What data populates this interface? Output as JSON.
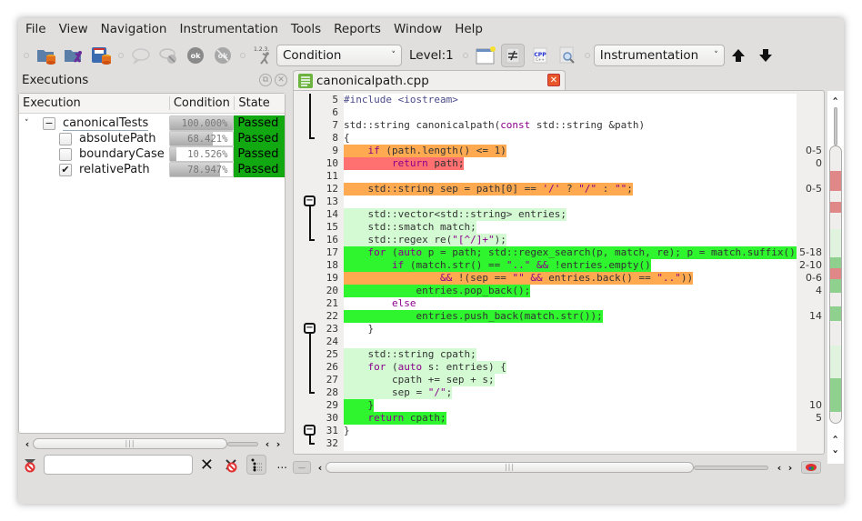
{
  "menu": [
    "File",
    "View",
    "Navigation",
    "Instrumentation",
    "Tools",
    "Reports",
    "Window",
    "Help"
  ],
  "toolbar": {
    "buttons": [
      "open-database-icon",
      "open-execution-icon",
      "save-database-icon",
      "comment-icon",
      "remove-comment-icon",
      "ok-icon",
      "undo-ok-icon",
      "level-stepper-icon"
    ],
    "coverage_method": "Condition",
    "level_label": "Level:1",
    "instrumentation_filter": "Instrumentation",
    "step_icon_label": "1.2.3."
  },
  "executions_dock": {
    "title": "Executions",
    "columns": [
      "Execution",
      "Condition %",
      "State"
    ],
    "rows": [
      {
        "name": "canonicalTests",
        "coverage": "100.000%",
        "coverage_value": 100.0,
        "state": "Passed",
        "checked": "partial",
        "level": 0
      },
      {
        "name": "absolutePath",
        "coverage": "68.421%",
        "coverage_value": 68.421,
        "state": "Passed",
        "checked": false,
        "level": 1
      },
      {
        "name": "boundaryCase",
        "coverage": "10.526%",
        "coverage_value": 10.526,
        "state": "Passed",
        "checked": false,
        "level": 1
      },
      {
        "name": "relativePath",
        "coverage": "78.947%",
        "coverage_value": 78.947,
        "state": "Passed",
        "checked": true,
        "level": 1
      }
    ],
    "filter_value": "",
    "more_label": "..."
  },
  "editor": {
    "tab_title": "canonicalpath.cpp",
    "lines": [
      {
        "n": 5,
        "text": "#include <iostream>",
        "bg": "none",
        "hits": ""
      },
      {
        "n": 6,
        "text": "",
        "bg": "none",
        "hits": ""
      },
      {
        "n": 7,
        "text": "std::string canonicalpath(const std::string &path)",
        "bg": "none",
        "hits": ""
      },
      {
        "n": 8,
        "text": "{",
        "bg": "none",
        "hits": ""
      },
      {
        "n": 9,
        "text": "    if (path.length() <= 1)",
        "bg": "orange",
        "hits": "0-5"
      },
      {
        "n": 10,
        "text": "        return path;",
        "bg": "red",
        "hits": "0"
      },
      {
        "n": 11,
        "text": "",
        "bg": "none",
        "hits": ""
      },
      {
        "n": 12,
        "text": "    std::string sep = path[0] == '/' ? \"/\" : \"\";",
        "bg": "orange",
        "hits": "0-5"
      },
      {
        "n": 13,
        "text": "",
        "bg": "none",
        "hits": ""
      },
      {
        "n": 14,
        "text": "    std::vector<std::string> entries;",
        "bg": "lightgreen",
        "hits": ""
      },
      {
        "n": 15,
        "text": "    std::smatch match;",
        "bg": "lightgreen",
        "hits": ""
      },
      {
        "n": 16,
        "text": "    std::regex re(\"[^/]+\");",
        "bg": "lightgreen",
        "hits": ""
      },
      {
        "n": 17,
        "text": "    for (auto p = path; std::regex_search(p, match, re); p = match.suffix())",
        "bg": "green",
        "hits": "5-18"
      },
      {
        "n": 18,
        "text": "        if (match.str() == \"..\" && !entries.empty()",
        "bg": "green",
        "hits": "2-10"
      },
      {
        "n": 19,
        "text": "                && !(sep == \"\" && entries.back() == \"..\"))",
        "bg": "orange",
        "hits": "0-6"
      },
      {
        "n": 20,
        "text": "            entries.pop_back();",
        "bg": "green",
        "hits": "4"
      },
      {
        "n": 21,
        "text": "        else",
        "bg": "none",
        "hits": ""
      },
      {
        "n": 22,
        "text": "            entries.push_back(match.str());",
        "bg": "green",
        "hits": "14"
      },
      {
        "n": 23,
        "text": "    }",
        "bg": "none",
        "hits": ""
      },
      {
        "n": 24,
        "text": "",
        "bg": "none",
        "hits": ""
      },
      {
        "n": 25,
        "text": "    std::string cpath;",
        "bg": "lightgreen",
        "hits": ""
      },
      {
        "n": 26,
        "text": "    for (auto s: entries) {",
        "bg": "lightgreen",
        "hits": ""
      },
      {
        "n": 27,
        "text": "        cpath += sep + s;",
        "bg": "lightgreen",
        "hits": ""
      },
      {
        "n": 28,
        "text": "        sep = \"/\";",
        "bg": "lightgreen",
        "hits": ""
      },
      {
        "n": 29,
        "text": "    }",
        "bg": "green",
        "hits": "10"
      },
      {
        "n": 30,
        "text": "    return cpath;",
        "bg": "green",
        "hits": "5"
      },
      {
        "n": 31,
        "text": "}",
        "bg": "none",
        "hits": ""
      },
      {
        "n": 32,
        "text": "",
        "bg": "none",
        "hits": ""
      }
    ]
  },
  "colors": {
    "orange": "#ffa950",
    "red": "#ff7070",
    "green": "#2ef52e",
    "lightgreen": "#d4fad4",
    "passed": "#12a812",
    "overview_red": "#e08888",
    "overview_green": "#8fd08f",
    "overview_lightgreen": "#dff3df"
  }
}
